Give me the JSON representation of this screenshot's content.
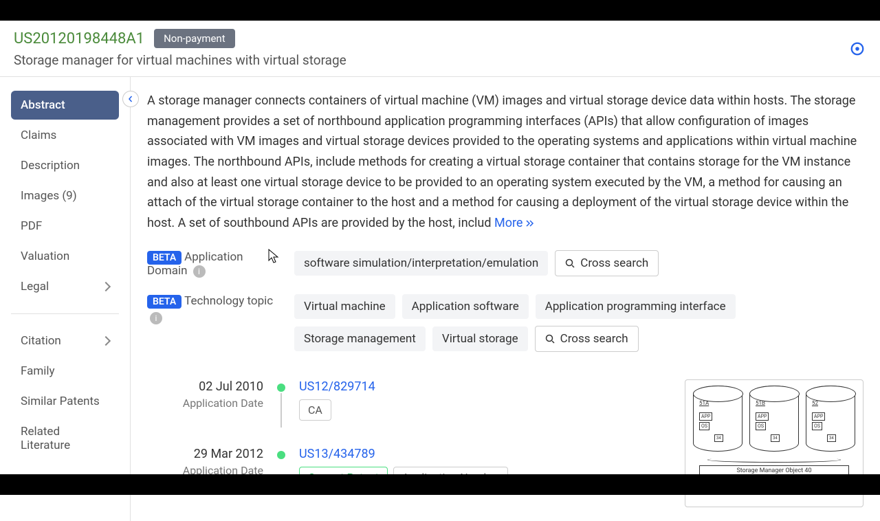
{
  "header": {
    "patent_id": "US20120198448A1",
    "status": "Non-payment",
    "title": "Storage manager for virtual machines with virtual storage"
  },
  "sidebar": {
    "group1": [
      {
        "label": "Abstract",
        "active": true
      },
      {
        "label": "Claims"
      },
      {
        "label": "Description"
      },
      {
        "label": "Images (9)"
      },
      {
        "label": "PDF"
      },
      {
        "label": "Valuation"
      },
      {
        "label": "Legal",
        "chevron": true
      }
    ],
    "group2": [
      {
        "label": "Citation",
        "chevron": true
      },
      {
        "label": "Family"
      },
      {
        "label": "Similar Patents"
      },
      {
        "label": "Related Literature"
      }
    ]
  },
  "abstract": {
    "text": "A storage manager connects containers of virtual machine (VM) images and virtual storage device data within hosts. The storage management provides a set of northbound application programming interfaces (APIs) that allow configuration of images associated with VM images and virtual storage devices provided to the operating systems and applications within virtual machine images. The northbound APIs, include methods for creating a virtual storage container that contains storage for the VM instance and also at least one virtual storage device to be provided to an operating system executed by the VM, a method for causing an attach of the virtual storage container to the host and a method for causing a deployment of the virtual storage device within the host. A set of southbound APIs are provided by the host, includ",
    "more": "More"
  },
  "meta": {
    "beta": "BETA",
    "domain_label": "Application Domain",
    "domain_tags": [
      "software simulation/interpretation/emulation"
    ],
    "topic_label": "Technology topic",
    "topic_tags": [
      "Virtual machine",
      "Application software",
      "Application programming interface",
      "Storage management",
      "Virtual storage"
    ],
    "cross_search": "Cross search"
  },
  "timeline": [
    {
      "date": "02 Jul 2010",
      "sublabel": "Application Date",
      "link": "US12/829714",
      "badges": [
        {
          "text": "CA"
        }
      ]
    },
    {
      "date": "29 Mar 2012",
      "sublabel": "Application Date",
      "link": "US13/434789",
      "badges": [
        {
          "text": "Current Patent",
          "green": true
        },
        {
          "text": "Application Number"
        }
      ]
    }
  ],
  "figure": {
    "caption": "Storage Manager Object 40",
    "cyl_labels": [
      "51A",
      "51B",
      "52"
    ]
  }
}
